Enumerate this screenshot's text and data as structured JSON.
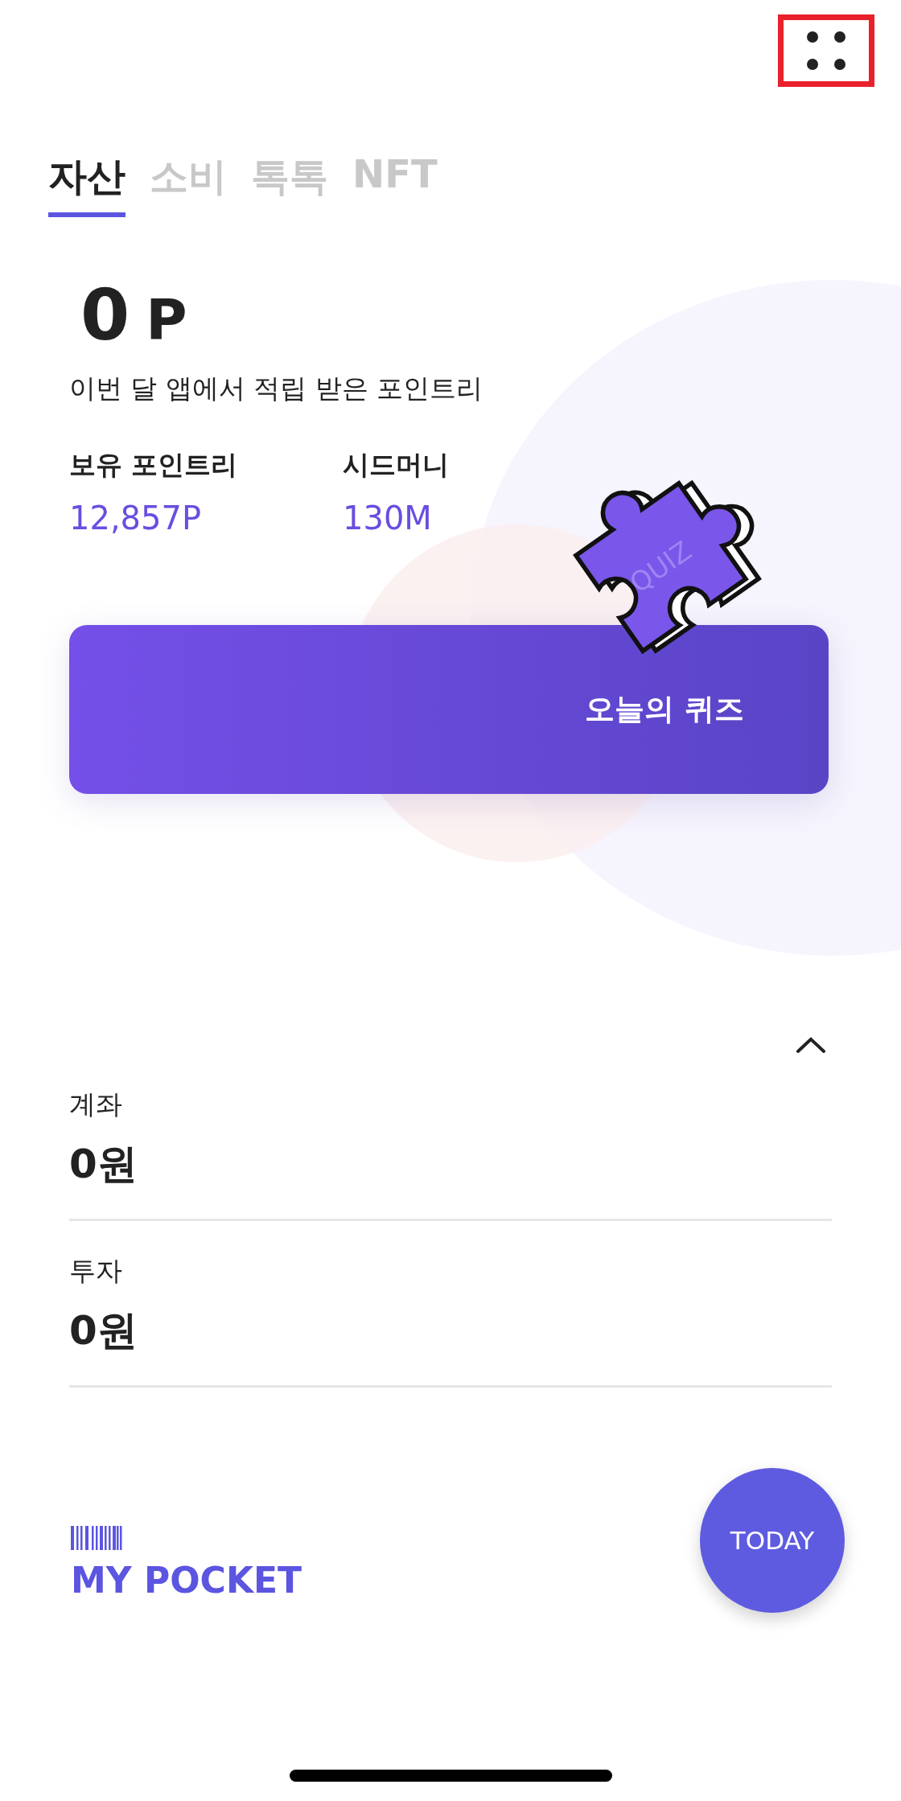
{
  "tabs": [
    {
      "label": "자산",
      "selected": true
    },
    {
      "label": "소비",
      "selected": false
    },
    {
      "label": "톡톡",
      "selected": false
    },
    {
      "label": "NFT",
      "selected": false
    }
  ],
  "points": {
    "value": "0",
    "unit": "P",
    "caption": "이번 달 앱에서 적립 받은 포인트리"
  },
  "stats": [
    {
      "label": "보유 포인트리",
      "value": "12,857P"
    },
    {
      "label": "시드머니",
      "value": "130M"
    }
  ],
  "quiz": {
    "badge": "QUIZ",
    "button": "오늘의 퀴즈"
  },
  "accounts": {
    "expanded": true,
    "items": [
      {
        "label": "계좌",
        "amount": "0원"
      },
      {
        "label": "투자",
        "amount": "0원"
      }
    ]
  },
  "pocket": {
    "label": "MY POCKET"
  },
  "today_button": "TODAY"
}
